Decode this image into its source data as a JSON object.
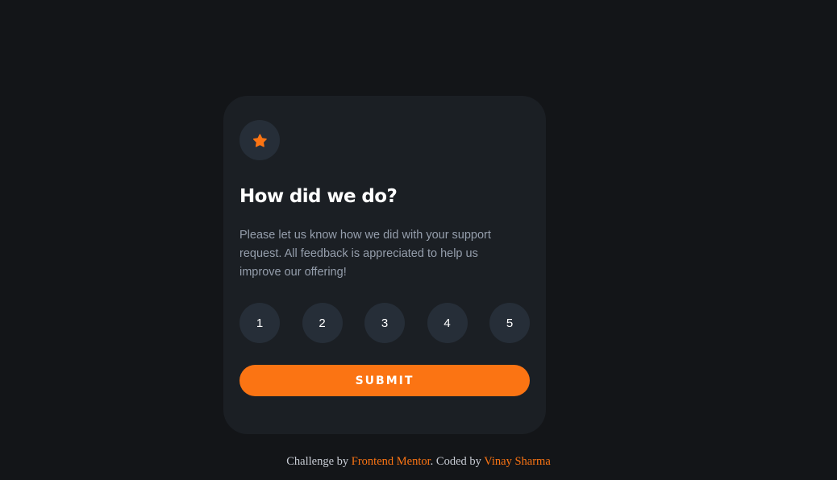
{
  "card": {
    "icon": "star-icon",
    "title": "How did we do?",
    "description": "Please let us know how we did with your support request. All feedback is appreciated to help us improve our offering!",
    "ratings": [
      "1",
      "2",
      "3",
      "4",
      "5"
    ],
    "submit_label": "SUBMIT"
  },
  "attribution": {
    "prefix": "Challenge by ",
    "challenge_link": "Frontend Mentor",
    "middle": ". Coded by ",
    "author_link": "Vinay Sharma"
  },
  "colors": {
    "background": "#131518",
    "card": "#1b1f24",
    "circle": "#262e38",
    "accent": "#fb7413",
    "text_muted": "#959eac",
    "text_white": "#ffffff"
  }
}
